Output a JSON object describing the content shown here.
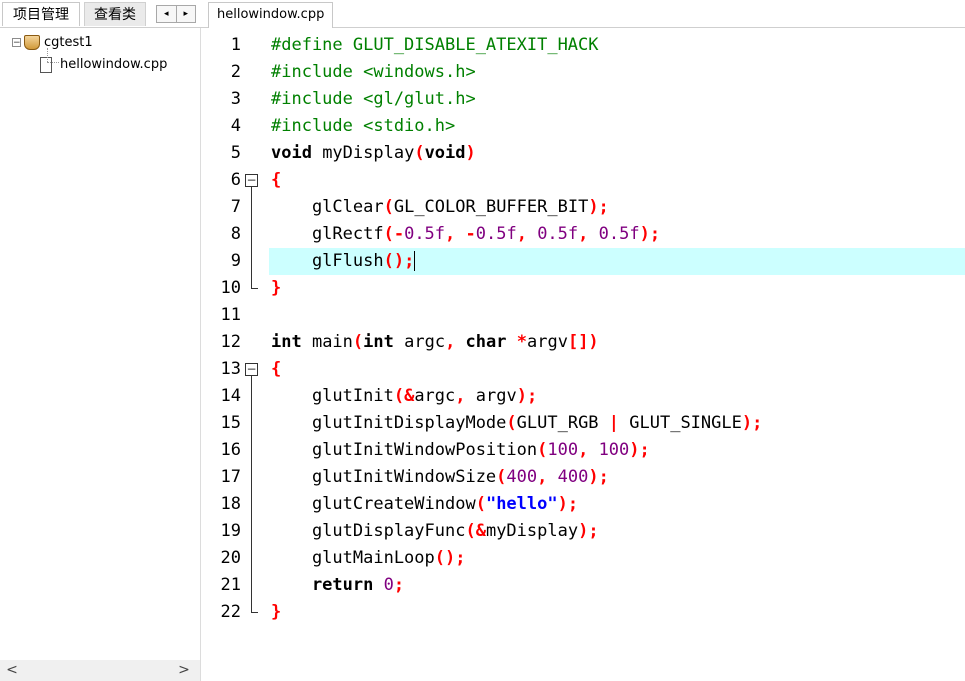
{
  "left_panel": {
    "tabs": [
      {
        "label": "项目管理",
        "active": true
      },
      {
        "label": "查看类",
        "active": false
      }
    ],
    "scroll_left": "◂",
    "scroll_right": "▸",
    "tree": {
      "expander": "−",
      "project": "cgtest1",
      "file": "hellowindow.cpp"
    },
    "hscroll_left": "<",
    "hscroll_right": ">"
  },
  "editor": {
    "tab_label": "hellowindow.cpp",
    "current_line": 9,
    "fold_marker": "−",
    "lines": [
      [
        {
          "t": "pp",
          "v": "#define GLUT_DISABLE_ATEXIT_HACK"
        }
      ],
      [
        {
          "t": "pp",
          "v": "#include <windows.h>"
        }
      ],
      [
        {
          "t": "pp",
          "v": "#include <gl/glut.h>"
        }
      ],
      [
        {
          "t": "pp",
          "v": "#include <stdio.h>"
        }
      ],
      [
        {
          "t": "kw",
          "v": "void"
        },
        {
          "t": "txt",
          "v": " myDisplay"
        },
        {
          "t": "sym",
          "v": "("
        },
        {
          "t": "kw",
          "v": "void"
        },
        {
          "t": "sym",
          "v": ")"
        }
      ],
      [
        {
          "t": "sym",
          "v": "{"
        }
      ],
      [
        {
          "t": "txt",
          "v": "    glClear"
        },
        {
          "t": "sym",
          "v": "("
        },
        {
          "t": "txt",
          "v": "GL_COLOR_BUFFER_BIT"
        },
        {
          "t": "sym",
          "v": ");"
        }
      ],
      [
        {
          "t": "txt",
          "v": "    glRectf"
        },
        {
          "t": "sym",
          "v": "(-"
        },
        {
          "t": "num",
          "v": "0.5f"
        },
        {
          "t": "sym",
          "v": ", -"
        },
        {
          "t": "num",
          "v": "0.5f"
        },
        {
          "t": "sym",
          "v": ", "
        },
        {
          "t": "num",
          "v": "0.5f"
        },
        {
          "t": "sym",
          "v": ", "
        },
        {
          "t": "num",
          "v": "0.5f"
        },
        {
          "t": "sym",
          "v": ");"
        }
      ],
      [
        {
          "t": "txt",
          "v": "    glFlush"
        },
        {
          "t": "sym",
          "v": "();"
        }
      ],
      [
        {
          "t": "sym",
          "v": "}"
        }
      ],
      [],
      [
        {
          "t": "kw",
          "v": "int"
        },
        {
          "t": "txt",
          "v": " main"
        },
        {
          "t": "sym",
          "v": "("
        },
        {
          "t": "kw",
          "v": "int"
        },
        {
          "t": "txt",
          "v": " argc"
        },
        {
          "t": "sym",
          "v": ", "
        },
        {
          "t": "kw",
          "v": "char"
        },
        {
          "t": "txt",
          "v": " "
        },
        {
          "t": "sym",
          "v": "*"
        },
        {
          "t": "txt",
          "v": "argv"
        },
        {
          "t": "sym",
          "v": "[])"
        }
      ],
      [
        {
          "t": "sym",
          "v": "{"
        }
      ],
      [
        {
          "t": "txt",
          "v": "    glutInit"
        },
        {
          "t": "sym",
          "v": "(&"
        },
        {
          "t": "txt",
          "v": "argc"
        },
        {
          "t": "sym",
          "v": ", "
        },
        {
          "t": "txt",
          "v": "argv"
        },
        {
          "t": "sym",
          "v": ");"
        }
      ],
      [
        {
          "t": "txt",
          "v": "    glutInitDisplayMode"
        },
        {
          "t": "sym",
          "v": "("
        },
        {
          "t": "txt",
          "v": "GLUT_RGB "
        },
        {
          "t": "sym",
          "v": "|"
        },
        {
          "t": "txt",
          "v": " GLUT_SINGLE"
        },
        {
          "t": "sym",
          "v": ");"
        }
      ],
      [
        {
          "t": "txt",
          "v": "    glutInitWindowPosition"
        },
        {
          "t": "sym",
          "v": "("
        },
        {
          "t": "num",
          "v": "100"
        },
        {
          "t": "sym",
          "v": ", "
        },
        {
          "t": "num",
          "v": "100"
        },
        {
          "t": "sym",
          "v": ");"
        }
      ],
      [
        {
          "t": "txt",
          "v": "    glutInitWindowSize"
        },
        {
          "t": "sym",
          "v": "("
        },
        {
          "t": "num",
          "v": "400"
        },
        {
          "t": "sym",
          "v": ", "
        },
        {
          "t": "num",
          "v": "400"
        },
        {
          "t": "sym",
          "v": ");"
        }
      ],
      [
        {
          "t": "txt",
          "v": "    glutCreateWindow"
        },
        {
          "t": "sym",
          "v": "("
        },
        {
          "t": "str",
          "v": "\"hello\""
        },
        {
          "t": "sym",
          "v": ");"
        }
      ],
      [
        {
          "t": "txt",
          "v": "    glutDisplayFunc"
        },
        {
          "t": "sym",
          "v": "(&"
        },
        {
          "t": "txt",
          "v": "myDisplay"
        },
        {
          "t": "sym",
          "v": ");"
        }
      ],
      [
        {
          "t": "txt",
          "v": "    glutMainLoop"
        },
        {
          "t": "sym",
          "v": "();"
        }
      ],
      [
        {
          "t": "kw",
          "v": "    return"
        },
        {
          "t": "txt",
          "v": " "
        },
        {
          "t": "num",
          "v": "0"
        },
        {
          "t": "sym",
          "v": ";"
        }
      ],
      [
        {
          "t": "sym",
          "v": "}"
        }
      ]
    ],
    "line_numbers": [
      "1",
      "2",
      "3",
      "4",
      "5",
      "6",
      "7",
      "8",
      "9",
      "10",
      "11",
      "12",
      "13",
      "14",
      "15",
      "16",
      "17",
      "18",
      "19",
      "20",
      "21",
      "22"
    ]
  }
}
